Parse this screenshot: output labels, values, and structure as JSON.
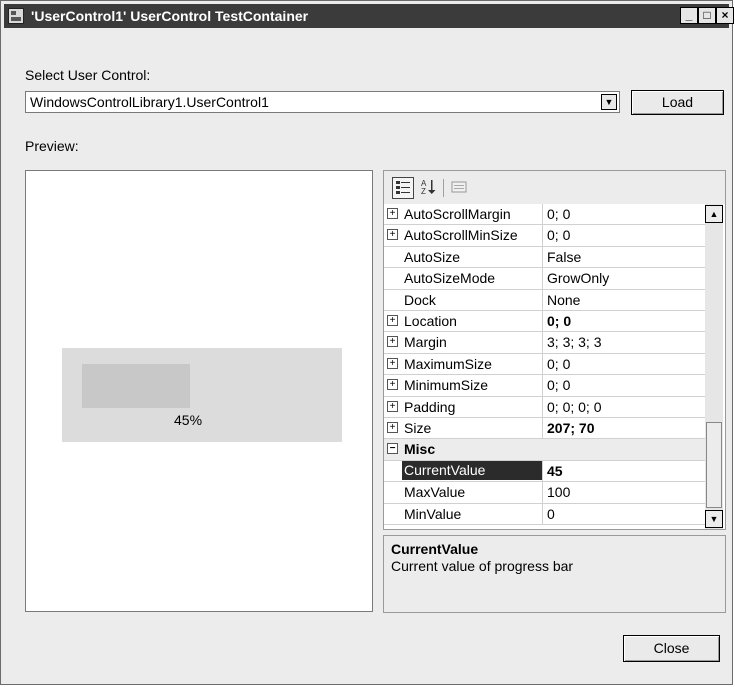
{
  "window": {
    "title": "'UserControl1' UserControl TestContainer",
    "min_glyph": "_",
    "max_glyph": "□",
    "close_glyph": "×"
  },
  "select": {
    "label": "Select User Control:",
    "value": "WindowsControlLibrary1.UserControl1",
    "dropdown_glyph": "▼",
    "load_label": "Load"
  },
  "preview": {
    "label": "Preview:",
    "progress_fraction": 0.45,
    "progress_text": "45%"
  },
  "property_grid": {
    "toolbar": {
      "categorized_icon": "categorized-icon",
      "alphabetical_icon": "alphabetical-icon",
      "property_pages_icon": "property-pages-icon"
    },
    "rows": [
      {
        "type": "prop",
        "expandable": true,
        "name": "AutoScrollMargin",
        "value": "0; 0",
        "bold": false
      },
      {
        "type": "prop",
        "expandable": true,
        "name": "AutoScrollMinSize",
        "value": "0; 0",
        "bold": false
      },
      {
        "type": "prop",
        "expandable": false,
        "name": "AutoSize",
        "value": "False",
        "bold": false
      },
      {
        "type": "prop",
        "expandable": false,
        "name": "AutoSizeMode",
        "value": "GrowOnly",
        "bold": false
      },
      {
        "type": "prop",
        "expandable": false,
        "name": "Dock",
        "value": "None",
        "bold": false
      },
      {
        "type": "prop",
        "expandable": true,
        "name": "Location",
        "value": "0; 0",
        "bold": true
      },
      {
        "type": "prop",
        "expandable": true,
        "name": "Margin",
        "value": "3; 3; 3; 3",
        "bold": false
      },
      {
        "type": "prop",
        "expandable": true,
        "name": "MaximumSize",
        "value": "0; 0",
        "bold": false
      },
      {
        "type": "prop",
        "expandable": true,
        "name": "MinimumSize",
        "value": "0; 0",
        "bold": false
      },
      {
        "type": "prop",
        "expandable": true,
        "name": "Padding",
        "value": "0; 0; 0; 0",
        "bold": false
      },
      {
        "type": "prop",
        "expandable": true,
        "name": "Size",
        "value": "207; 70",
        "bold": true
      },
      {
        "type": "category",
        "expandable": true,
        "name": "Misc",
        "value": "",
        "bold": true
      },
      {
        "type": "prop",
        "expandable": false,
        "name": "CurrentValue",
        "value": "45",
        "bold": true,
        "selected": true
      },
      {
        "type": "prop",
        "expandable": false,
        "name": "MaxValue",
        "value": "100",
        "bold": false
      },
      {
        "type": "prop",
        "expandable": false,
        "name": "MinValue",
        "value": "0",
        "bold": false
      }
    ],
    "description": {
      "title": "CurrentValue",
      "text": "Current value of progress bar"
    }
  },
  "footer": {
    "close_label": "Close"
  }
}
